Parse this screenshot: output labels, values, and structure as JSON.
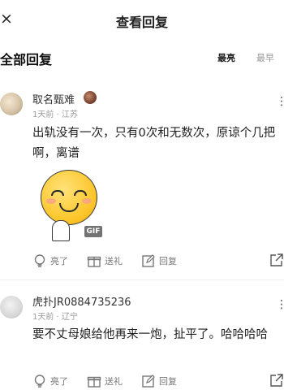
{
  "header": {
    "close_icon": "×",
    "title": "查看回复"
  },
  "section": {
    "title": "全部回复",
    "sort_hot": "最亮",
    "sort_new": "最早"
  },
  "comments": [
    {
      "username": "取名甄难",
      "meta": "1天前 · 江苏",
      "content": "出轨没有一次，只有0次和无数次，原谅个几把啊，离谱",
      "gif_label": "GIF",
      "actions": {
        "like": "亮了",
        "gift": "送礼",
        "reply": "回复"
      }
    },
    {
      "username": "虎扑JR0884735236",
      "meta": "1天前 · 辽宁",
      "content": "要不丈母娘给他再来一炮，扯平了。哈哈哈哈",
      "actions": {
        "like": "亮了",
        "gift": "送礼",
        "reply": "回复"
      }
    }
  ]
}
